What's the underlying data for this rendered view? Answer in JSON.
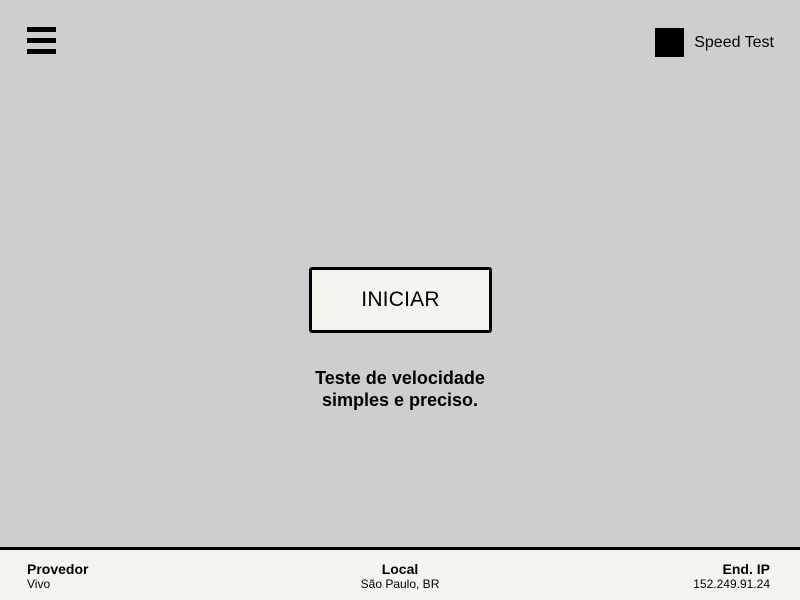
{
  "header": {
    "menu_icon": "hamburger-menu-icon",
    "brand_logo_icon": "black-square-logo",
    "app_title": "Speed Test"
  },
  "main": {
    "start_button_label": "INICIAR",
    "tagline_line1": "Teste de velocidade",
    "tagline_line2": "simples e preciso."
  },
  "footer": {
    "provider_label": "Provedor",
    "provider_value": "Vivo",
    "location_label": "Local",
    "location_value": "São Paulo, BR",
    "ip_label": "End. IP",
    "ip_value": "152.249.91.24"
  },
  "colors": {
    "background": "#cecece",
    "button_bg": "#f5f5f0",
    "footer_bg": "#f5f5f0",
    "text": "#000000"
  }
}
